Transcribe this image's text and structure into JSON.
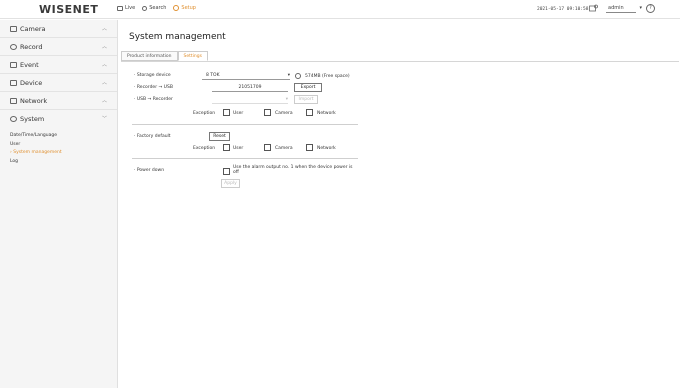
{
  "header": {
    "logo": "WISENET",
    "nav": [
      {
        "label": "Live",
        "icon": "live-icon"
      },
      {
        "label": "Search",
        "icon": "search-icon"
      },
      {
        "label": "Setup",
        "icon": "gear-icon"
      }
    ],
    "datetime": "2021-05-17 09:10:58",
    "user": "admin"
  },
  "sidebar": {
    "items": [
      {
        "label": "Camera",
        "icon": "camera-icon"
      },
      {
        "label": "Record",
        "icon": "record-icon"
      },
      {
        "label": "Event",
        "icon": "event-icon"
      },
      {
        "label": "Device",
        "icon": "device-icon"
      },
      {
        "label": "Network",
        "icon": "network-icon"
      },
      {
        "label": "System",
        "icon": "system-icon"
      }
    ],
    "system_submenu": [
      "Date/Time/Language",
      "User",
      "System management",
      "Log"
    ]
  },
  "main": {
    "title": "System management",
    "tabs": [
      "Product information",
      "Settings"
    ],
    "storage_device_label": "Storage device",
    "storage_device_value": "8 TOK",
    "free_space": "574MB (Free space)",
    "recorder_to_usb_label": "Recorder → USB",
    "recorder_to_usb_value": "21051709",
    "usb_to_recorder_label": "USB → Recorder",
    "export_label": "Export",
    "import_label": "Import",
    "exception_label": "Exception",
    "exceptions": [
      "User",
      "Camera",
      "Network"
    ],
    "factory_default_label": "Factory default",
    "reset_label": "Reset",
    "power_down_label": "Power down",
    "power_down_text_1": "Use the alarm output no. 1 when the device power is",
    "power_down_text_2": "off",
    "apply_label": "Apply"
  },
  "colors": {
    "accent": "#e09030"
  }
}
